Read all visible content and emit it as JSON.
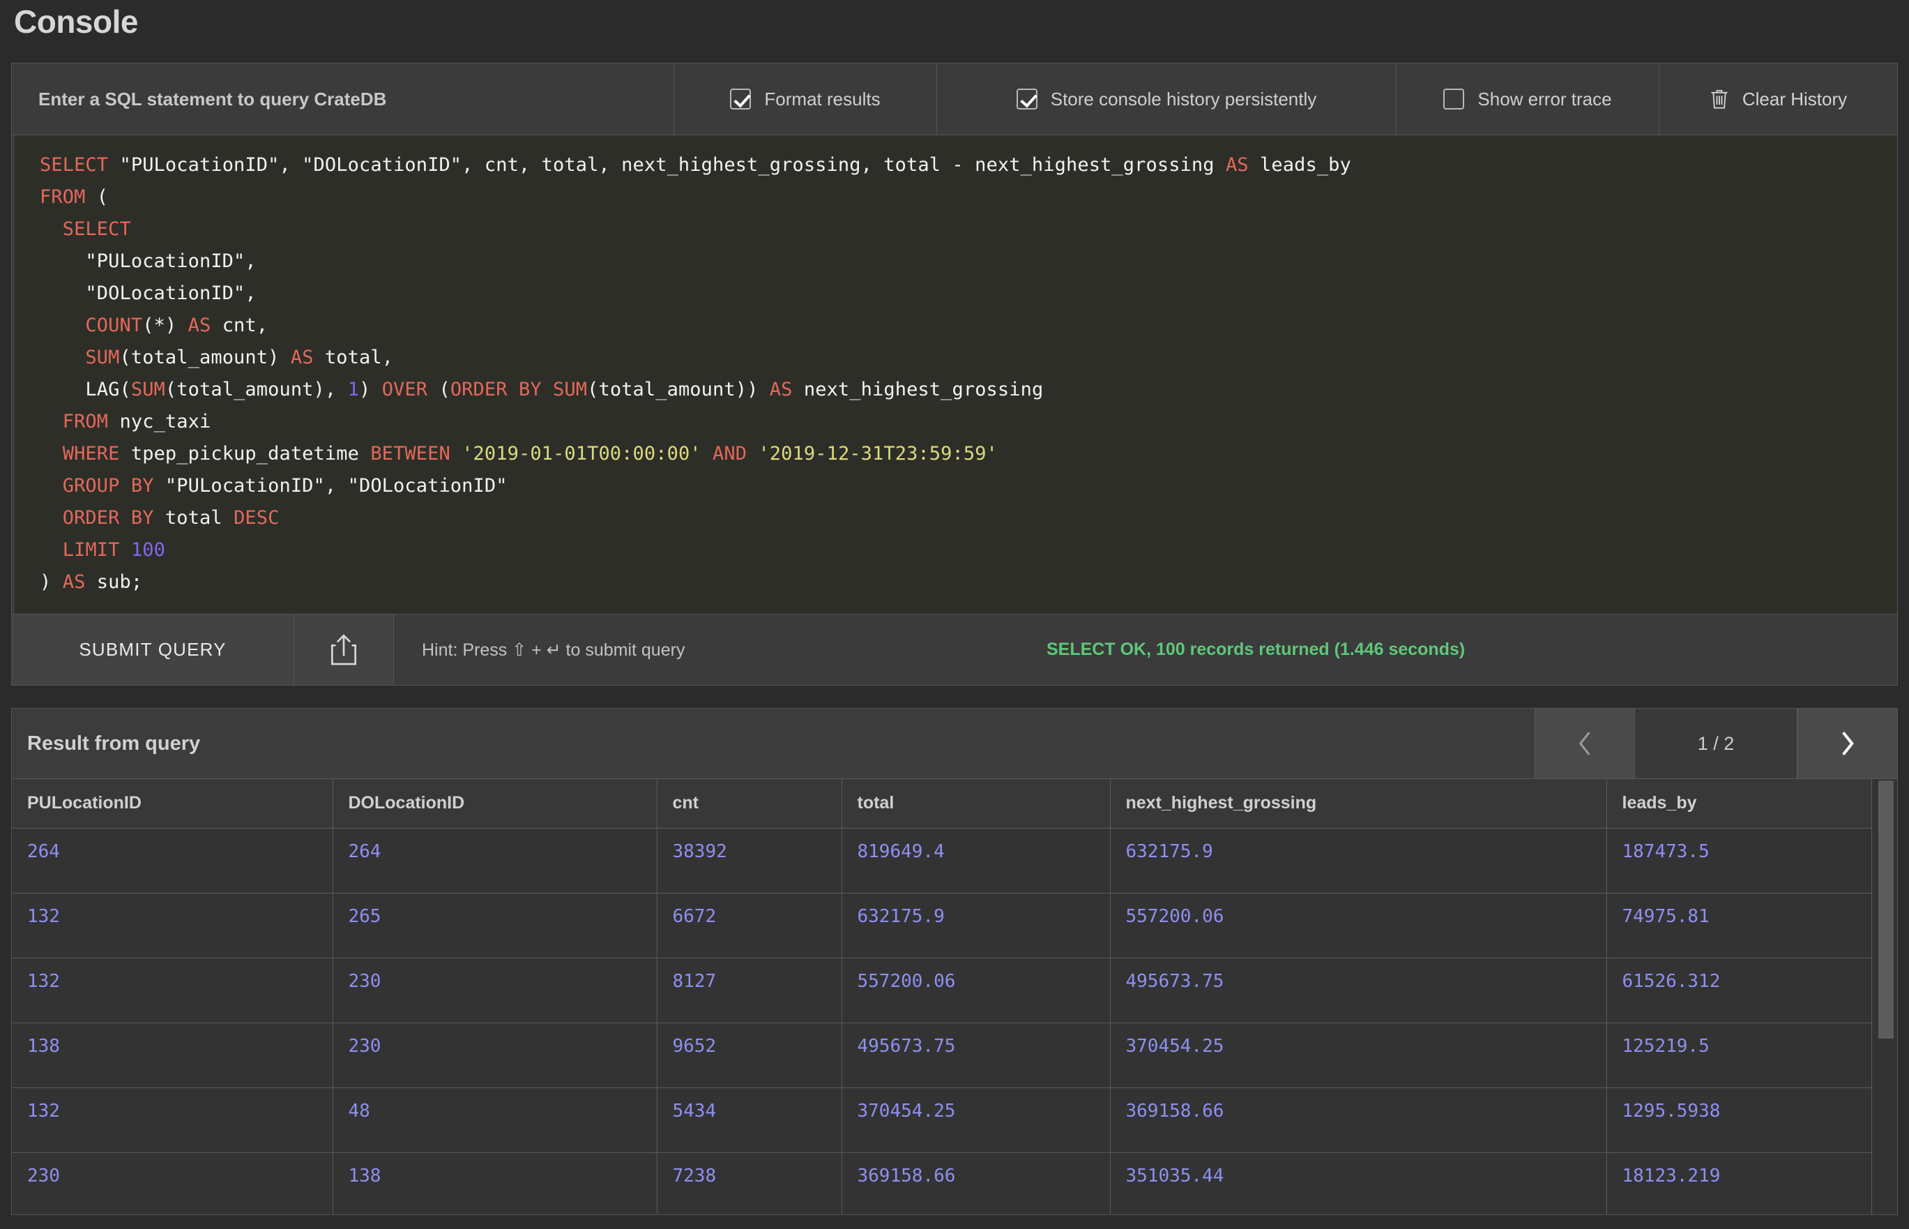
{
  "header": {
    "title": "Console"
  },
  "toolbar": {
    "prompt": "Enter a SQL statement to query CrateDB",
    "format_results": {
      "label": "Format results",
      "checked": true
    },
    "store_history": {
      "label": "Store console history persistently",
      "checked": true
    },
    "show_error_trace": {
      "label": "Show error trace",
      "checked": false
    },
    "clear_history": {
      "label": "Clear History",
      "icon": "trash-icon"
    }
  },
  "editor": {
    "lines": [
      [
        {
          "t": "SELECT",
          "c": "kw"
        },
        {
          "t": " \"PULocationID\", \"DOLocationID\", cnt, total, next_highest_grossing, total - next_highest_grossing ",
          "c": ""
        },
        {
          "t": "AS",
          "c": "kw"
        },
        {
          "t": " leads_by",
          "c": ""
        }
      ],
      [
        {
          "t": "FROM",
          "c": "kw"
        },
        {
          "t": " (",
          "c": ""
        }
      ],
      [
        {
          "t": "  ",
          "c": ""
        },
        {
          "t": "SELECT",
          "c": "kw"
        }
      ],
      [
        {
          "t": "    \"PULocationID\",",
          "c": ""
        }
      ],
      [
        {
          "t": "    \"DOLocationID\",",
          "c": ""
        }
      ],
      [
        {
          "t": "    ",
          "c": ""
        },
        {
          "t": "COUNT",
          "c": "kw"
        },
        {
          "t": "(*) ",
          "c": ""
        },
        {
          "t": "AS",
          "c": "kw"
        },
        {
          "t": " cnt,",
          "c": ""
        }
      ],
      [
        {
          "t": "    ",
          "c": ""
        },
        {
          "t": "SUM",
          "c": "kw"
        },
        {
          "t": "(total_amount) ",
          "c": ""
        },
        {
          "t": "AS",
          "c": "kw"
        },
        {
          "t": " total,",
          "c": ""
        }
      ],
      [
        {
          "t": "    LAG(",
          "c": ""
        },
        {
          "t": "SUM",
          "c": "kw"
        },
        {
          "t": "(total_amount), ",
          "c": ""
        },
        {
          "t": "1",
          "c": "num"
        },
        {
          "t": ") ",
          "c": ""
        },
        {
          "t": "OVER",
          "c": "kw"
        },
        {
          "t": " (",
          "c": ""
        },
        {
          "t": "ORDER BY",
          "c": "kw"
        },
        {
          "t": " ",
          "c": ""
        },
        {
          "t": "SUM",
          "c": "kw"
        },
        {
          "t": "(total_amount)) ",
          "c": ""
        },
        {
          "t": "AS",
          "c": "kw"
        },
        {
          "t": " next_highest_grossing",
          "c": ""
        }
      ],
      [
        {
          "t": "  ",
          "c": ""
        },
        {
          "t": "FROM",
          "c": "kw"
        },
        {
          "t": " nyc_taxi",
          "c": ""
        }
      ],
      [
        {
          "t": "  ",
          "c": ""
        },
        {
          "t": "WHERE",
          "c": "kw"
        },
        {
          "t": " tpep_pickup_datetime ",
          "c": ""
        },
        {
          "t": "BETWEEN",
          "c": "kw"
        },
        {
          "t": " ",
          "c": ""
        },
        {
          "t": "'2019-01-01T00:00:00'",
          "c": "str"
        },
        {
          "t": " ",
          "c": ""
        },
        {
          "t": "AND",
          "c": "kw"
        },
        {
          "t": " ",
          "c": ""
        },
        {
          "t": "'2019-12-31T23:59:59'",
          "c": "str"
        }
      ],
      [
        {
          "t": "  ",
          "c": ""
        },
        {
          "t": "GROUP BY",
          "c": "kw"
        },
        {
          "t": " \"PULocationID\", \"DOLocationID\"",
          "c": ""
        }
      ],
      [
        {
          "t": "  ",
          "c": ""
        },
        {
          "t": "ORDER BY",
          "c": "kw"
        },
        {
          "t": " total ",
          "c": ""
        },
        {
          "t": "DESC",
          "c": "kw"
        }
      ],
      [
        {
          "t": "  ",
          "c": ""
        },
        {
          "t": "LIMIT",
          "c": "kw"
        },
        {
          "t": " ",
          "c": ""
        },
        {
          "t": "100",
          "c": "num"
        }
      ],
      [
        {
          "t": ") ",
          "c": ""
        },
        {
          "t": "AS",
          "c": "kw"
        },
        {
          "t": " sub;",
          "c": ""
        }
      ]
    ]
  },
  "submit_bar": {
    "submit_label": "SUBMIT QUERY",
    "share_icon": "share-upload-icon",
    "hint": "Hint: Press ⇧ + ↵ to submit query",
    "status": "SELECT OK, 100 records returned (1.446 seconds)",
    "status_color": "#5ec77a"
  },
  "result": {
    "title": "Result from query",
    "pager": {
      "prev_icon": "chevron-left-icon",
      "next_icon": "chevron-right-icon",
      "page_label": "1 / 2",
      "prev_disabled": true
    },
    "columns": [
      "PULocationID",
      "DOLocationID",
      "cnt",
      "total",
      "next_highest_grossing",
      "leads_by"
    ],
    "rows": [
      [
        "264",
        "264",
        "38392",
        "819649.4",
        "632175.9",
        "187473.5"
      ],
      [
        "132",
        "265",
        "6672",
        "632175.9",
        "557200.06",
        "74975.81"
      ],
      [
        "132",
        "230",
        "8127",
        "557200.06",
        "495673.75",
        "61526.312"
      ],
      [
        "138",
        "230",
        "9652",
        "495673.75",
        "370454.25",
        "125219.5"
      ],
      [
        "132",
        "48",
        "5434",
        "370454.25",
        "369158.66",
        "1295.5938"
      ],
      [
        "230",
        "138",
        "7238",
        "369158.66",
        "351035.44",
        "18123.219"
      ]
    ]
  }
}
